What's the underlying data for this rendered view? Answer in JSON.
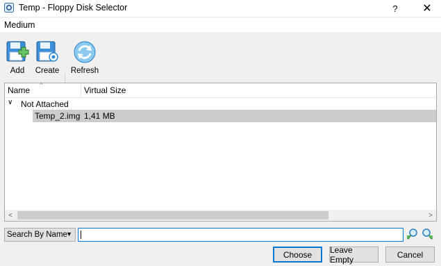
{
  "window": {
    "title": "Temp - Floppy Disk Selector",
    "help_glyph": "?",
    "close_glyph": "✕",
    "icon": "virtualbox-app-icon"
  },
  "menubar": {
    "medium_label": "Medium"
  },
  "toolbar": {
    "add_label": "Add",
    "create_label": "Create",
    "refresh_label": "Refresh",
    "add_icon": "floppy-add-icon",
    "create_icon": "floppy-create-icon",
    "refresh_icon": "refresh-icon"
  },
  "table": {
    "columns": [
      "Name",
      "Virtual Size"
    ],
    "groups": [
      {
        "label": "Not Attached",
        "items": [
          {
            "name": "Temp_2.img",
            "size": "1,41 MB",
            "selected": true
          }
        ]
      }
    ]
  },
  "search": {
    "mode_label": "Search By Name",
    "value": "",
    "prev_icon": "search-backward-icon",
    "next_icon": "search-forward-icon"
  },
  "buttons": {
    "choose": "Choose",
    "leave_empty": "Leave Empty",
    "cancel": "Cancel"
  },
  "colors": {
    "accent": "#0078d7",
    "selection": "#cccccc",
    "icon_blue": "#2a8ad4",
    "icon_green": "#5cb85c"
  }
}
